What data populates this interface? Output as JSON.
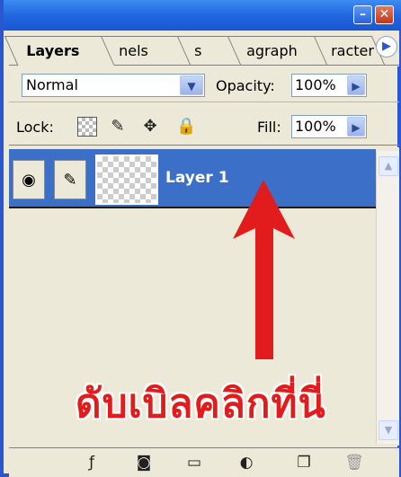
{
  "titlebar": {
    "minimize_icon": "minimize-icon",
    "close_icon": "close-icon",
    "min_glyph": "–",
    "close_glyph": "✕"
  },
  "tabs": [
    {
      "label": "Layers",
      "active": true
    },
    {
      "label": "nels",
      "active": false
    },
    {
      "label": "s",
      "active": false
    },
    {
      "label": "agraph",
      "active": false
    },
    {
      "label": "racter",
      "active": false
    }
  ],
  "tab_menu_glyph": "▶",
  "blend_mode": {
    "value": "Normal",
    "arrow": "▼"
  },
  "opacity": {
    "label": "Opacity:",
    "value": "100%",
    "arrow": "▶"
  },
  "lock": {
    "label": "Lock:",
    "brush_glyph": "✎",
    "move_glyph": "✥",
    "lock_glyph": "🔒"
  },
  "fill": {
    "label": "Fill:",
    "value": "100%",
    "arrow": "▶"
  },
  "layers": [
    {
      "name": "Layer 1",
      "visible": true,
      "selected": true,
      "eye_glyph": "◉",
      "brush_glyph": "✎"
    }
  ],
  "scroll": {
    "up": "▲",
    "down": "▼"
  },
  "annotation": {
    "text": "ดับเบิลคลิกที่นี่",
    "color": "#e21c1c"
  },
  "bottom_bar": {
    "fx_glyph": "ƒ",
    "mask_glyph": "◙",
    "folder_glyph": "▭",
    "adjust_glyph": "◐",
    "new_glyph": "❐",
    "trash_glyph": "🗑"
  },
  "colors": {
    "titlebar": "#2167e0",
    "selected_layer": "#3c6fc8",
    "panel_bg": "#ece9d8"
  }
}
